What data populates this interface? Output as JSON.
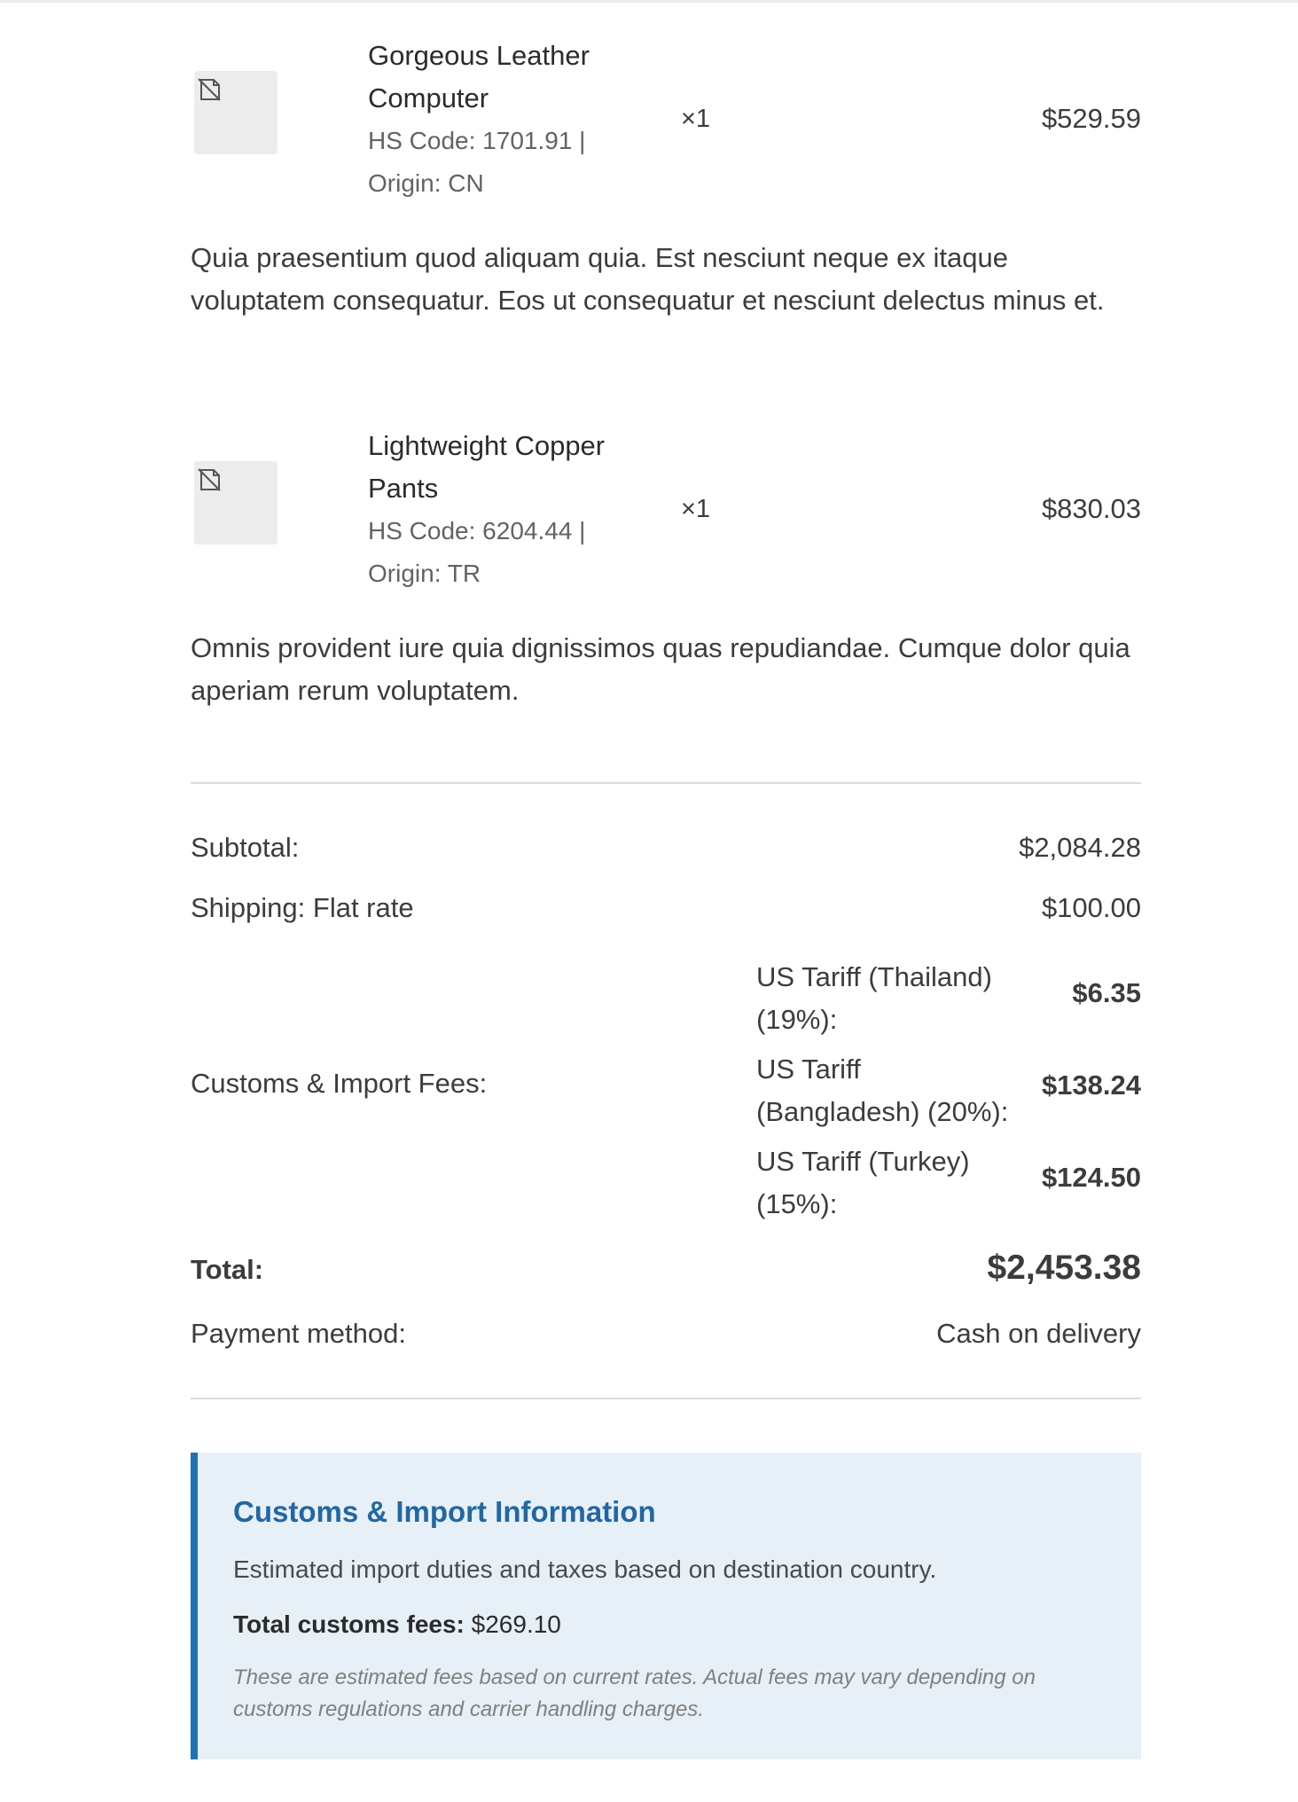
{
  "items": [
    {
      "name": "Gorgeous Leather Computer",
      "hs_code_line": "HS Code: 1701.91 |",
      "origin_line": "Origin: CN",
      "quantity": "×1",
      "price": "$529.59",
      "description": "Quia praesentium quod aliquam quia. Est nesciunt neque ex itaque voluptatem consequatur. Eos ut consequatur et nesciunt delectus minus et.",
      "image_icon": "broken-image-icon"
    },
    {
      "name": "Lightweight Copper Pants",
      "hs_code_line": "HS Code: 6204.44 |",
      "origin_line": "Origin: TR",
      "quantity": "×1",
      "price": "$830.03",
      "description": "Omnis provident iure quia dignissimos quas repudiandae. Cumque dolor quia aperiam rerum voluptatem.",
      "image_icon": "broken-image-icon"
    }
  ],
  "totals": {
    "subtotal_label": "Subtotal:",
    "subtotal_value": "$2,084.28",
    "shipping_label": "Shipping: Flat rate",
    "shipping_value": "$100.00",
    "customs_label": "Customs & Import Fees:",
    "fees": [
      {
        "name": "US Tariff (Thailand) (19%):",
        "amount": "$6.35"
      },
      {
        "name": "US Tariff (Bangladesh) (20%):",
        "amount": "$138.24"
      },
      {
        "name": "US Tariff (Turkey) (15%):",
        "amount": "$124.50"
      }
    ],
    "total_label": "Total:",
    "total_value": "$2,453.38",
    "payment_label": "Payment method:",
    "payment_value": "Cash on delivery"
  },
  "customs_info": {
    "title": "Customs & Import Information",
    "text": "Estimated import duties and taxes based on destination country.",
    "total_label": "Total customs fees:",
    "total_value": "$269.10",
    "note": "These are estimated fees based on current rates. Actual fees may vary depending on customs regulations and carrier handling charges.",
    "accent_color": "#2271b1"
  }
}
